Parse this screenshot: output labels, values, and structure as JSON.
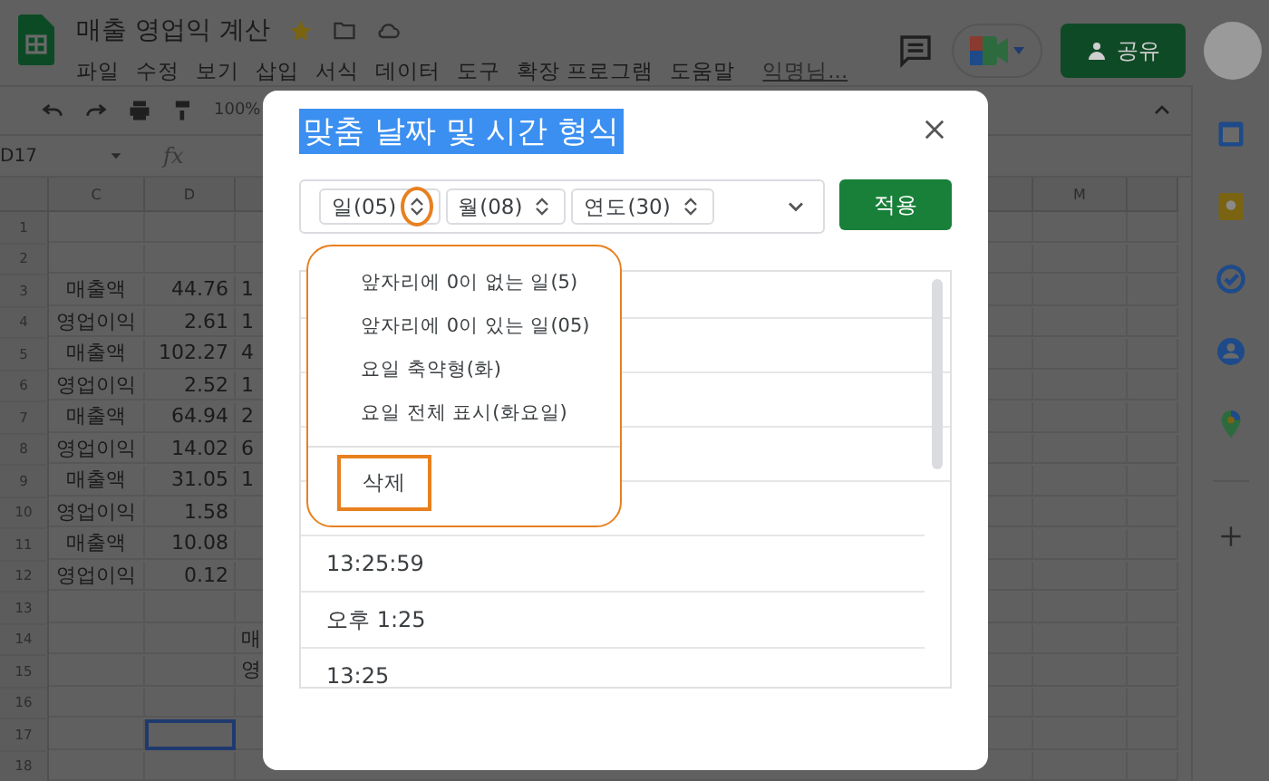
{
  "doc": {
    "title": "매출 영업익 계산",
    "menus": [
      "파일",
      "수정",
      "보기",
      "삽입",
      "서식",
      "데이터",
      "도구",
      "확장 프로그램",
      "도움말"
    ],
    "user_link": "익명님...",
    "share_button": "공유"
  },
  "toolbar": {
    "zoom": "100%"
  },
  "formula_bar": {
    "cell_ref": "D17",
    "fx_label": "fx"
  },
  "sheet": {
    "column_headers": [
      "C",
      "D",
      "M"
    ],
    "rows": [
      {
        "number": "1",
        "selected": false
      },
      {
        "number": "2",
        "selected": false
      },
      {
        "number": "3",
        "c": "매출액",
        "d": "44.76",
        "e": "1",
        "selected": false
      },
      {
        "number": "4",
        "c": "영업이익",
        "d": "2.61",
        "e": "1",
        "selected": false
      },
      {
        "number": "5",
        "c": "매출액",
        "d": "102.27",
        "e": "4",
        "selected": false
      },
      {
        "number": "6",
        "c": "영업이익",
        "d": "2.52",
        "e": "1",
        "selected": false
      },
      {
        "number": "7",
        "c": "매출액",
        "d": "64.94",
        "e": "2",
        "selected": false
      },
      {
        "number": "8",
        "c": "영업이익",
        "d": "14.02",
        "e": "6",
        "selected": false
      },
      {
        "number": "9",
        "c": "매출액",
        "d": "31.05",
        "e": "1",
        "selected": false
      },
      {
        "number": "10",
        "c": "영업이익",
        "d": "1.58",
        "selected": false
      },
      {
        "number": "11",
        "c": "매출액",
        "d": "10.08",
        "selected": false
      },
      {
        "number": "12",
        "c": "영업이익",
        "d": "0.12",
        "selected": false
      },
      {
        "number": "13",
        "selected": false
      },
      {
        "number": "14",
        "e": "매",
        "selected": false
      },
      {
        "number": "15",
        "e": "영",
        "selected": false
      },
      {
        "number": "16",
        "selected": false
      },
      {
        "number": "17",
        "selected": true
      },
      {
        "number": "18",
        "selected": false
      }
    ]
  },
  "dialog": {
    "title": "맞춤 날짜 및 시간 형식",
    "format_chips": [
      {
        "label": "일(05)",
        "highlighted": true
      },
      {
        "label": "월(08)",
        "highlighted": false
      },
      {
        "label": "연도(30)",
        "highlighted": false
      }
    ],
    "apply_button": "적용",
    "menu": {
      "items": [
        "앞자리에 0이 없는 일(5)",
        "앞자리에 0이 있는 일(05)",
        "요일 축약형(화)",
        "요일 전체 표시(화요일)"
      ],
      "delete_item": {
        "label": "삭제",
        "highlighted": true
      }
    },
    "formats": [
      "13:25:59",
      "오후 1:25",
      "13:25"
    ]
  }
}
